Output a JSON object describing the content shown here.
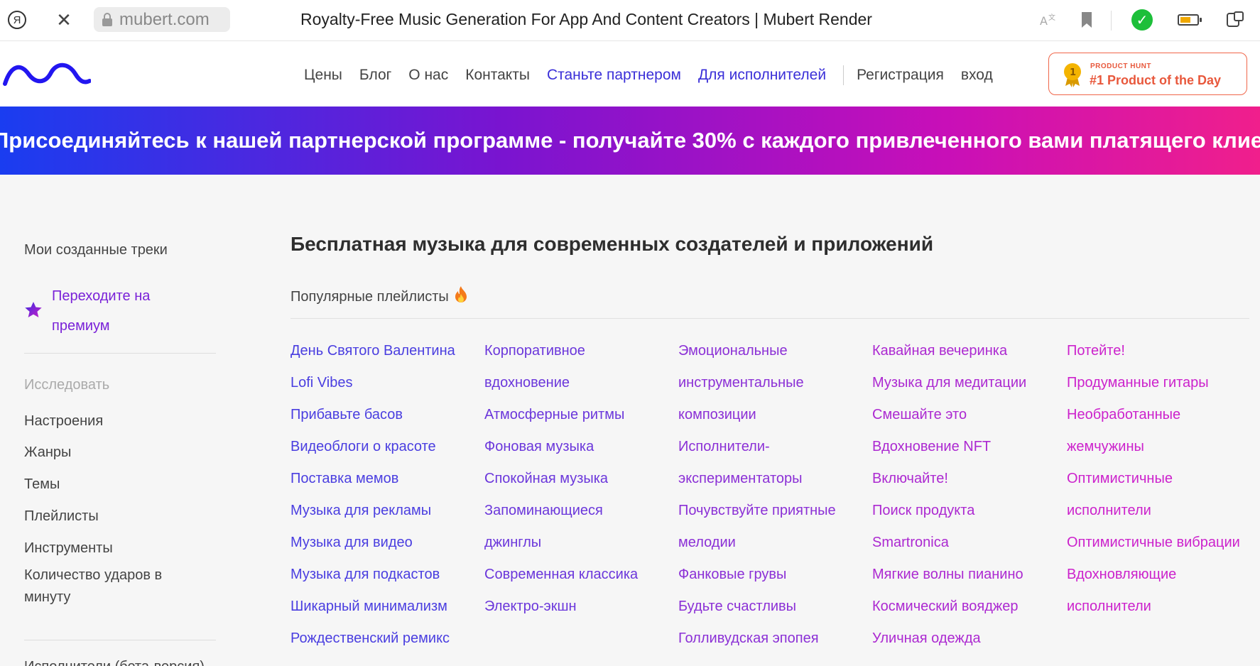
{
  "browser": {
    "url": "mubert.com",
    "title": "Royalty-Free Music Generation For App And Content Creators | Mubert Render"
  },
  "nav": {
    "items": [
      "Цены",
      "Блог",
      "О нас",
      "Контакты"
    ],
    "partner": "Станьте партнером",
    "artists": "Для исполнителей",
    "register": "Регистрация",
    "login": "вход"
  },
  "product_hunt": {
    "small": "PRODUCT HUNT",
    "big": "#1 Product of the Day"
  },
  "banner": "Присоединяйтесь к нашей партнерской программе - получайте 30% с каждого привлеченного вами платящего клиента",
  "sidebar": {
    "my_tracks": "Мои созданные треки",
    "premium_line1": "Переходите на",
    "premium_line2": "премиум",
    "explore": "Исследовать",
    "items": [
      "Настроения",
      "Жанры",
      "Темы",
      "Плейлисты",
      "Инструменты"
    ],
    "bpm_line1": "Количество ударов в",
    "bpm_line2": "минуту",
    "artists_beta": "Исполнители (бета-версия)"
  },
  "main": {
    "title": "Бесплатная музыка для современных создателей и приложений",
    "popular": "Популярные плейлисты"
  },
  "colors": {
    "link_start": "#4a3ee0",
    "link_end": "#cc22cc",
    "accent": "#7a22d8"
  },
  "playlists": {
    "col1": [
      "День Святого Валентина",
      "Lofi Vibes",
      "Прибавьте басов",
      "Видеоблоги о красоте",
      "Поставка мемов",
      "Музыка для рекламы",
      "Музыка для видео",
      "Музыка для подкастов",
      "Шикарный минимализм",
      "Рождественский ремикс"
    ],
    "col2": [
      "Корпоративное",
      "вдохновение",
      "Атмосферные ритмы",
      "Фоновая музыка",
      "Спокойная музыка",
      "Запоминающиеся",
      "джинглы",
      "Современная классика",
      "Электро-экшн"
    ],
    "col3": [
      "Эмоциональные",
      "инструментальные",
      "композиции",
      "Исполнители-",
      "экспериментаторы",
      "Почувствуйте приятные",
      "мелодии",
      "Фанковые грувы",
      "Будьте счастливы",
      "Голливудская эпопея"
    ],
    "col4": [
      "Кавайная вечеринка",
      "Музыка для медитации",
      "Смешайте это",
      "Вдохновение NFT",
      "Включайте!",
      "Поиск продукта",
      "Smartronica",
      "Мягкие волны пианино",
      "Космический вояджер",
      "Уличная одежда"
    ],
    "col5": [
      "Потейте!",
      "Продуманные гитары",
      "Необработанные",
      "жемчужины",
      "Оптимистичные",
      "исполнители",
      "Оптимистичные вибрации",
      "Вдохновляющие",
      "исполнители"
    ]
  }
}
